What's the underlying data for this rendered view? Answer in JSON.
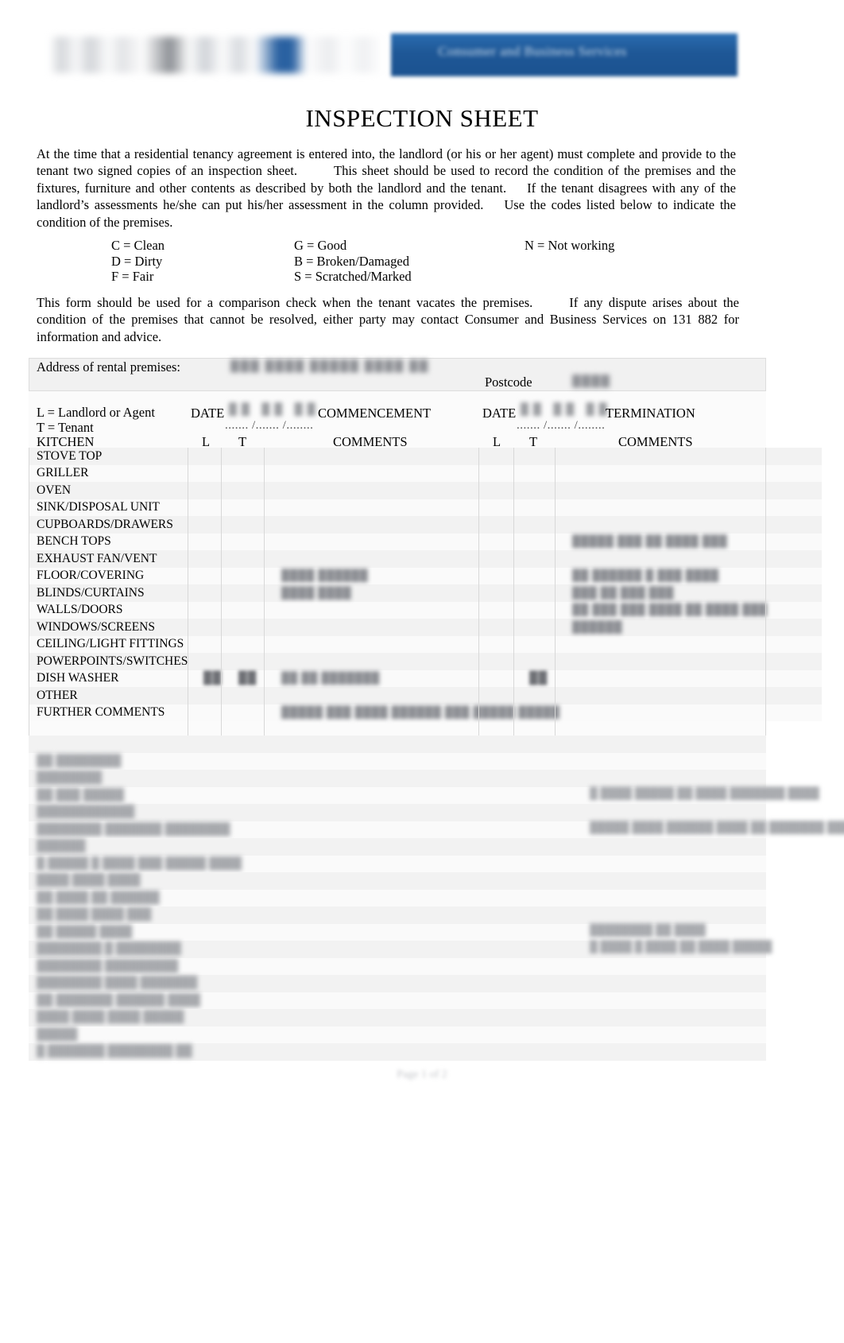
{
  "header": {
    "logo_alt": "government-logo",
    "banner_text": "Consumer and Business Services"
  },
  "title": "INSPECTION SHEET",
  "intro_paragraph": {
    "part1": "At the time that a residential tenancy agreement is entered into, the landlord (or his or her agent) must complete and provide to the tenant two signed copies of an inspection sheet.",
    "part2": "This sheet should be used to record the condition of the premises and the fixtures, furniture and other contents as described by both the landlord and the tenant.",
    "part3": "If the tenant disagrees with any of the landlord’s assessments he/she can put his/her assessment in the column provided.",
    "part4": "Use the codes listed below to indicate the condition of the premises."
  },
  "codes": [
    {
      "col1": "C = Clean",
      "col2": "G = Good",
      "col3": "N = Not working"
    },
    {
      "col1": "D = Dirty",
      "col2": "B = Broken/Damaged",
      "col3": ""
    },
    {
      "col1": "F = Fair",
      "col2": "S = Scratched/Marked",
      "col3": ""
    }
  ],
  "comparison_paragraph": {
    "part1": "This form should be used for a comparison check when the tenant vacates the premises.",
    "part2": "If any dispute arises about the condition of the premises that cannot be resolved, either party may contact Consumer and Business Services on 131 882 for information and advice."
  },
  "address_section": {
    "label": "Address of rental premises:",
    "value": "███ ████ █████ ████ ██",
    "postcode_label": "Postcode",
    "postcode_value": "████"
  },
  "legend": {
    "landlord": "L = Landlord or Agent",
    "tenant": "T = Tenant"
  },
  "date_headers": {
    "date_label_1": "DATE",
    "date_value_1": "....... /....... /........",
    "commencement": "COMMENCEMENT",
    "date_label_2": "DATE",
    "date_value_2": "....... /....... /........",
    "termination": "TERMINATION"
  },
  "column_headers": {
    "section": "KITCHEN",
    "l1": "L",
    "t1": "T",
    "comments1": "COMMENTS",
    "l2": "L",
    "t2": "T",
    "comments2": "COMMENTS"
  },
  "kitchen_rows": [
    {
      "label": "STOVE TOP",
      "l1": "",
      "t1": "",
      "c1": "",
      "l2": "",
      "t2": "",
      "c2": ""
    },
    {
      "label": "GRILLER",
      "l1": "",
      "t1": "",
      "c1": "",
      "l2": "",
      "t2": "",
      "c2": ""
    },
    {
      "label": "OVEN",
      "l1": "",
      "t1": "",
      "c1": "",
      "l2": "",
      "t2": "",
      "c2": ""
    },
    {
      "label": "SINK/DISPOSAL UNIT",
      "l1": "",
      "t1": "",
      "c1": "",
      "l2": "",
      "t2": "",
      "c2": ""
    },
    {
      "label": "CUPBOARDS/DRAWERS",
      "l1": "",
      "t1": "",
      "c1": "",
      "l2": "",
      "t2": "",
      "c2": ""
    },
    {
      "label": "BENCH TOPS",
      "l1": "",
      "t1": "",
      "c1": "",
      "l2": "",
      "t2": "",
      "c2": "█████ ███ ██ ████ ███"
    },
    {
      "label": "EXHAUST FAN/VENT",
      "l1": "",
      "t1": "",
      "c1": "",
      "l2": "",
      "t2": "",
      "c2": ""
    },
    {
      "label": "FLOOR/COVERING",
      "l1": "",
      "t1": "",
      "c1": "████ ██████",
      "l2": "",
      "t2": "",
      "c2": "██ ██████ █ ███ ████"
    },
    {
      "label": "BLINDS/CURTAINS",
      "l1": "",
      "t1": "",
      "c1": "████ ████",
      "l2": "",
      "t2": "",
      "c2": "███ ██ ███ ███"
    },
    {
      "label": "WALLS/DOORS",
      "l1": "",
      "t1": "",
      "c1": "",
      "l2": "",
      "t2": "",
      "c2": "██ ███ ███ ████ ██ ████ ███"
    },
    {
      "label": "WINDOWS/SCREENS",
      "l1": "",
      "t1": "",
      "c1": "",
      "l2": "",
      "t2": "",
      "c2": "██████"
    },
    {
      "label": "CEILING/LIGHT FITTINGS",
      "l1": "",
      "t1": "",
      "c1": "",
      "l2": "",
      "t2": "",
      "c2": ""
    },
    {
      "label": "POWERPOINTS/SWITCHES",
      "l1": "",
      "t1": "",
      "c1": "",
      "l2": "",
      "t2": "",
      "c2": ""
    },
    {
      "label": "DISH WASHER",
      "l1": "██",
      "t1": "██",
      "c1": "██  ██ ███████",
      "l2": "",
      "t2": "██",
      "c2": ""
    },
    {
      "label": "OTHER",
      "l1": "",
      "t1": "",
      "c1": "",
      "l2": "",
      "t2": "",
      "c2": ""
    },
    {
      "label": "FURTHER COMMENTS",
      "l1": "",
      "t1": "",
      "c1": "█████ ███ ████ ██████ ███ █████ █████",
      "l2": "",
      "t2": "",
      "c2": ""
    }
  ],
  "lower_section_rows": [
    {
      "label": "",
      "note_right": ""
    },
    {
      "label": "██ ████████",
      "note_right": ""
    },
    {
      "label": "████████",
      "note_right": ""
    },
    {
      "label": "██ ███ █████",
      "note_right": "█ ████ █████ ██ ████ ███████ ████"
    },
    {
      "label": "████████████",
      "note_right": ""
    },
    {
      "label": "████████ ███████ ████████",
      "note_right": "█████ ████ ██████ ████ ██ ███████ ████"
    },
    {
      "label": "██████",
      "note_right": ""
    },
    {
      "label": "█ █████ █ ████ ███ █████ ████",
      "note_right": ""
    },
    {
      "label": "████ ████ ████",
      "note_right": ""
    },
    {
      "label": "██ ████ ██ ██████",
      "note_right": ""
    },
    {
      "label": "██ ████ ████ ███",
      "note_right": ""
    },
    {
      "label": "██ █████ ████",
      "note_right": "████████ ██ ████"
    },
    {
      "label": "████████ █ ████████",
      "note_right": "█ ████ █ ████ ██ ████ █████"
    },
    {
      "label": "████████ █████████",
      "note_right": ""
    },
    {
      "label": "████████ ████ ███████",
      "note_right": ""
    },
    {
      "label": "██ ███████ ██████ ████",
      "note_right": ""
    },
    {
      "label": "████ ████ ████ █████",
      "note_right": ""
    },
    {
      "label": "█████",
      "note_right": ""
    },
    {
      "label": "█ ███████ ████████ ██",
      "note_right": ""
    }
  ],
  "footer": {
    "page_label": "Page 1 of 2"
  },
  "colors": {
    "banner_blue": "#1e5796",
    "row_stripe_dark": "#f2f2f2",
    "row_stripe_light": "#fafafa",
    "grid_line": "#d8d8d8"
  }
}
